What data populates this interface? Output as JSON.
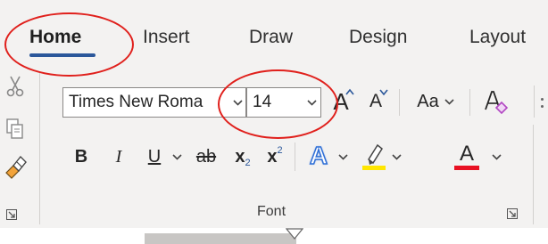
{
  "tabs": [
    {
      "label": "Home",
      "active": true
    },
    {
      "label": "Insert",
      "active": false
    },
    {
      "label": "Draw",
      "active": false
    },
    {
      "label": "Design",
      "active": false
    },
    {
      "label": "Layout",
      "active": false
    }
  ],
  "font": {
    "family_value": "Times New Roma",
    "size_value": "14",
    "group_label": "Font"
  },
  "icons": {
    "cut": "scissors-icon",
    "copy": "copy-icon",
    "format_painter": "paintbrush-icon",
    "grow": "grow-font-icon",
    "shrink": "shrink-font-icon",
    "change_case": "change-case-icon",
    "clear_format": "clear-formatting-icon"
  },
  "format_buttons": {
    "bold": "B",
    "italic": "I",
    "underline": "U",
    "strike": "ab",
    "subscript": "x",
    "superscript": "x",
    "case_label": "Aa",
    "grow_glyph": "A",
    "shrink_glyph": "A",
    "text_effects": "A",
    "font_color": "A"
  },
  "colors": {
    "tab_underline": "#2b579a",
    "highlight": "#ffe600",
    "font_color_bar": "#e81123",
    "annotation": "#e0201c",
    "text_effects": "#2f6fd6"
  }
}
